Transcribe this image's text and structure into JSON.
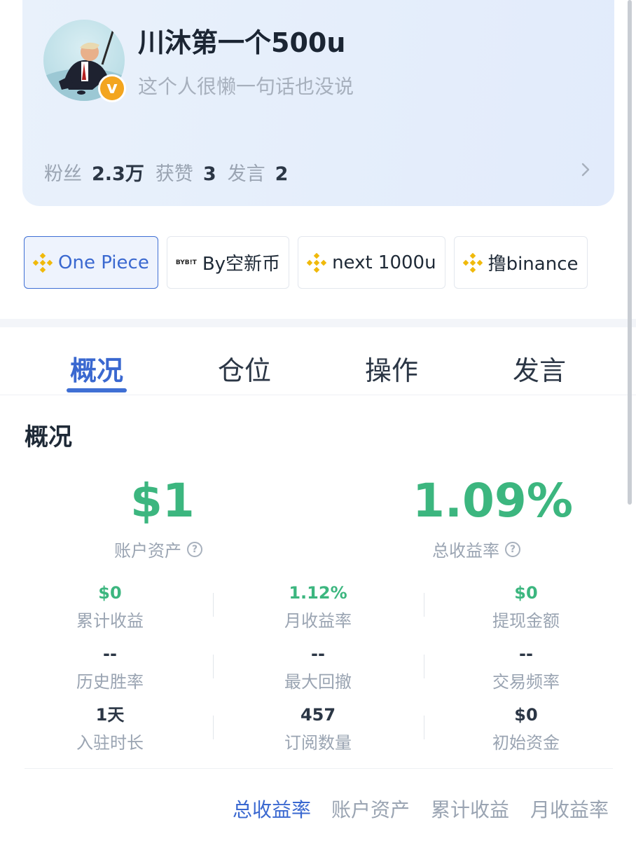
{
  "profile": {
    "username": "川沐第一个500u",
    "bio": "这个人很懒一句话也没说",
    "badge": "v",
    "stats": [
      {
        "label": "粉丝",
        "value": "2.3万"
      },
      {
        "label": "获赞",
        "value": "3"
      },
      {
        "label": "发言",
        "value": "2"
      }
    ]
  },
  "accounts": [
    {
      "label": "One Piece",
      "exchange_icon": "binance-icon",
      "active": true
    },
    {
      "label": "By空新币",
      "exchange_icon": "bybit-icon",
      "mark": "BYB!T",
      "active": false
    },
    {
      "label": "next 1000u",
      "exchange_icon": "binance-icon",
      "active": false
    },
    {
      "label": "撸binance",
      "exchange_icon": "binance-icon",
      "active": false
    }
  ],
  "tabs": [
    {
      "label": "概况",
      "active": true
    },
    {
      "label": "仓位",
      "active": false
    },
    {
      "label": "操作",
      "active": false
    },
    {
      "label": "发言",
      "active": false
    }
  ],
  "overview": {
    "title": "概况",
    "account_assets": {
      "value": "$1",
      "label": "账户资产"
    },
    "total_return": {
      "value": "1.09%",
      "label": "总收益率"
    },
    "metrics": [
      {
        "value": "$0",
        "label": "累计收益",
        "green": true
      },
      {
        "value": "1.12%",
        "label": "月收益率",
        "green": true
      },
      {
        "value": "$0",
        "label": "提现金额",
        "green": true
      },
      {
        "value": "--",
        "label": "历史胜率",
        "green": false
      },
      {
        "value": "--",
        "label": "最大回撤",
        "green": false
      },
      {
        "value": "--",
        "label": "交易频率",
        "green": false
      },
      {
        "value": "1天",
        "label": "入驻时长",
        "green": false
      },
      {
        "value": "457",
        "label": "订阅数量",
        "green": false
      },
      {
        "value": "$0",
        "label": "初始资金",
        "green": false
      }
    ]
  },
  "chart_tabs": [
    {
      "label": "总收益率",
      "active": true
    },
    {
      "label": "账户资产",
      "active": false
    },
    {
      "label": "累计收益",
      "active": false
    },
    {
      "label": "月收益率",
      "active": false
    }
  ],
  "colors": {
    "accent": "#3f6fd4",
    "positive": "#3cb67f",
    "binance": "#f0b90b",
    "badge": "#f3a51f"
  }
}
